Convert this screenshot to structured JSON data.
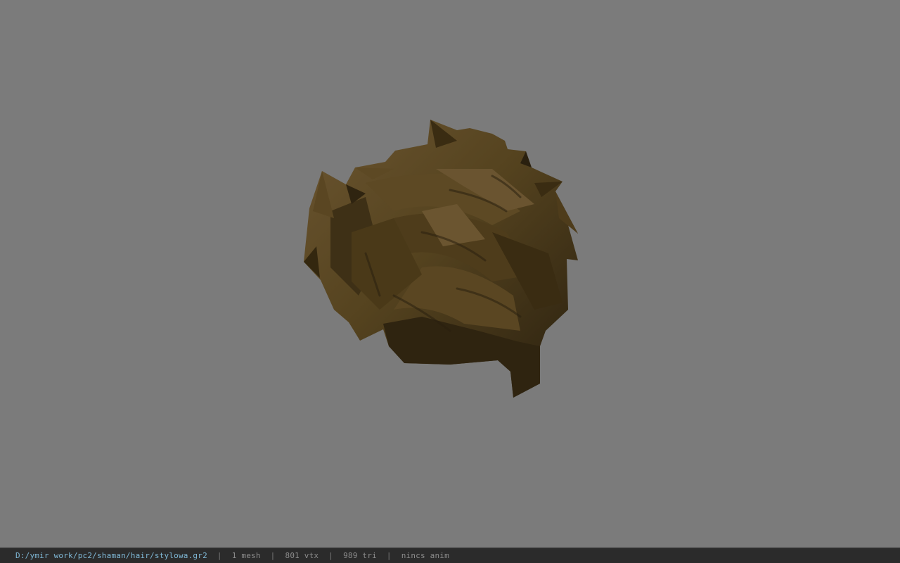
{
  "viewport": {
    "background_color": "#7b7b7b",
    "model_name": "hair mesh",
    "hair_base_color": "#4a3a20",
    "hair_shadow_color": "#2a200f",
    "hair_highlight_color": "#6b5530"
  },
  "statusbar": {
    "file_path": "D:/ymir work/pc2/shaman/hair/stylowa.gr2",
    "mesh_count": "1 mesh",
    "vertex_count": "801 vtx",
    "triangle_count": "989 tri",
    "anim_status": "nincs anim",
    "separator": "|"
  }
}
